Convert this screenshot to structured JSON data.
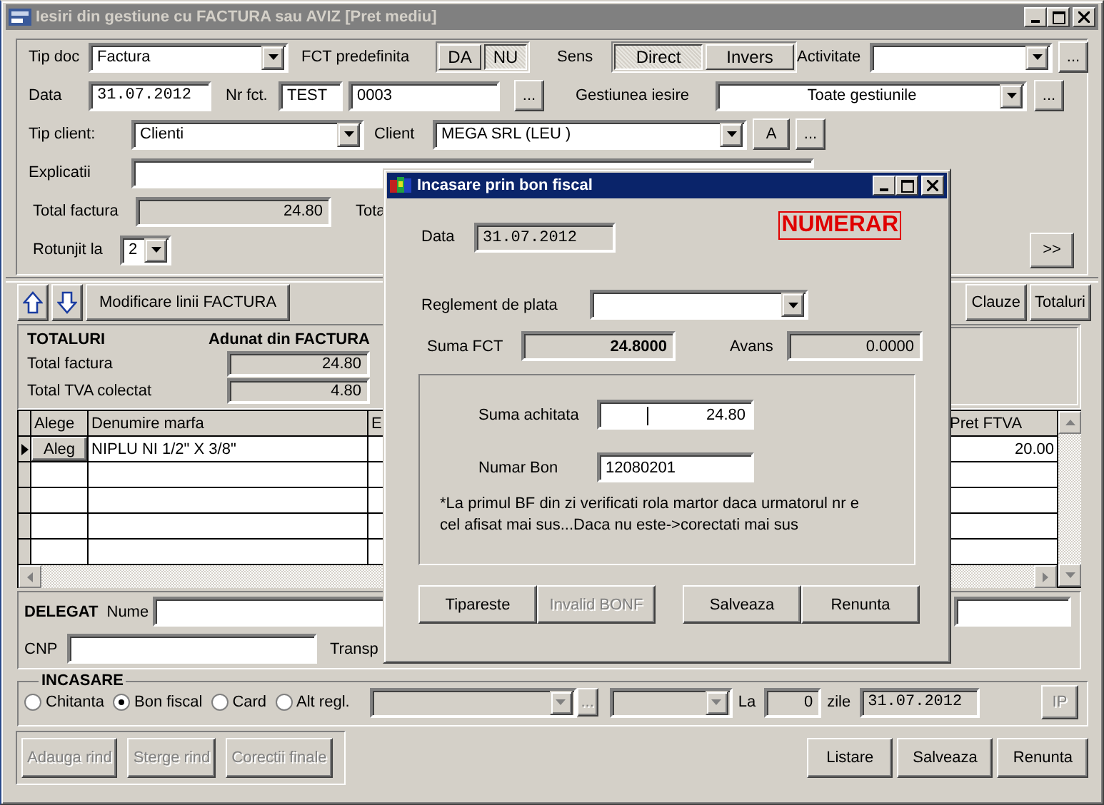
{
  "window": {
    "title": "Iesiri din gestiune cu FACTURA sau AVIZ [Pret mediu]",
    "active": false
  },
  "header": {
    "tip_doc": {
      "label": "Tip doc",
      "value": "Factura"
    },
    "fct_predefinita": {
      "label": "FCT predefinita",
      "options": [
        {
          "label": "DA",
          "selected": false
        },
        {
          "label": "NU",
          "selected": true
        }
      ]
    },
    "sens": {
      "label": "Sens",
      "options": [
        {
          "label": "Direct",
          "selected": true
        },
        {
          "label": "Invers",
          "selected": false
        }
      ]
    },
    "activitate": {
      "label": "Activitate",
      "browse": "..."
    },
    "data": {
      "label": "Data",
      "value": "31.07.2012"
    },
    "nr_fct": {
      "label": "Nr fct.",
      "series": "TEST",
      "number": "0003",
      "browse": "..."
    },
    "gestiunea": {
      "label": "Gestiunea iesire",
      "value": "Toate gestiunile",
      "browse": "..."
    },
    "tip_client": {
      "label": "Tip client:",
      "value": "Clienti"
    },
    "client": {
      "label": "Client",
      "value": "MEGA SRL (LEU )",
      "buttons": [
        "A",
        "..."
      ]
    },
    "explicatii": {
      "label": "Explicatii"
    },
    "total_factura": {
      "label": "Total factura",
      "value": "24.80"
    },
    "total_cut": "Tota",
    "rotunjit": {
      "label": "Rotunjit la",
      "value": "2"
    },
    "more_button": ">>"
  },
  "toolbar": {
    "modify_button": "Modificare linii FACTURA",
    "buttons": [
      "Clauze",
      "Totaluri"
    ]
  },
  "totals": {
    "title": "TOTALURI",
    "source": "Adunat din FACTURA",
    "rows": [
      {
        "label": "Total factura",
        "value": "24.80"
      },
      {
        "label": "Total TVA colectat",
        "value": "4.80"
      }
    ]
  },
  "grid": {
    "columns": [
      "Alege",
      "Denumire marfa",
      "E",
      "Pret FTVA"
    ],
    "rows": [
      {
        "current": true,
        "button": "Aleg",
        "name": "NIPLU NI 1/2\" X 3/8\"",
        "price": "20.00"
      }
    ]
  },
  "delegat": {
    "title": "DELEGAT",
    "name_label": "Nume",
    "cnp_label": "CNP",
    "transport_label": "Transp"
  },
  "incasare": {
    "title": "INCASARE",
    "options": [
      {
        "label": "Chitanta",
        "selected": false
      },
      {
        "label": "Bon fiscal",
        "selected": true
      },
      {
        "label": "Card",
        "selected": false
      },
      {
        "label": "Alt regl.",
        "selected": false
      }
    ],
    "browse": {
      "label": "...",
      "disabled": true
    },
    "days_label": "La",
    "days": "0",
    "days_unit": "zile",
    "date": "31.07.2012",
    "ip_button": {
      "label": "IP",
      "disabled": true
    }
  },
  "footer": {
    "left_buttons": [
      {
        "label": "Adauga rind",
        "disabled": true
      },
      {
        "label": "Sterge rind",
        "disabled": true
      },
      {
        "label": "Corectii finale",
        "disabled": true
      }
    ],
    "right_buttons": [
      {
        "label": "Listare",
        "disabled": false
      },
      {
        "label": "Salveaza",
        "disabled": false
      },
      {
        "label": "Renunta",
        "disabled": false
      }
    ]
  },
  "dialog": {
    "title": "Incasare prin bon fiscal",
    "active": true,
    "data_label": "Data",
    "data": {
      "value": "31.07.2012",
      "disabled": true
    },
    "mode": "NUMERAR",
    "reglement_label": "Reglement de plata",
    "suma_fct_label": "Suma FCT",
    "suma_fct": {
      "value": "24.8000",
      "disabled": true
    },
    "avans_label": "Avans",
    "avans": {
      "value": "0.0000",
      "disabled": true
    },
    "suma_achitata_label": "Suma achitata",
    "suma_achitata": {
      "value": "24.80",
      "disabled": false
    },
    "numar_bon_label": "Numar Bon",
    "numar_bon": {
      "value": "12080201",
      "disabled": false
    },
    "note": "*La primul BF din zi verificati rola martor daca urmatorul nr e cel afisat mai sus...Daca nu este->corectati mai sus",
    "buttons": [
      {
        "label": "Tipareste",
        "disabled": false
      },
      {
        "label": "Invalid BONF",
        "disabled": true
      },
      {
        "label": "Salveaza",
        "disabled": false
      },
      {
        "label": "Renunta",
        "disabled": false
      }
    ]
  }
}
